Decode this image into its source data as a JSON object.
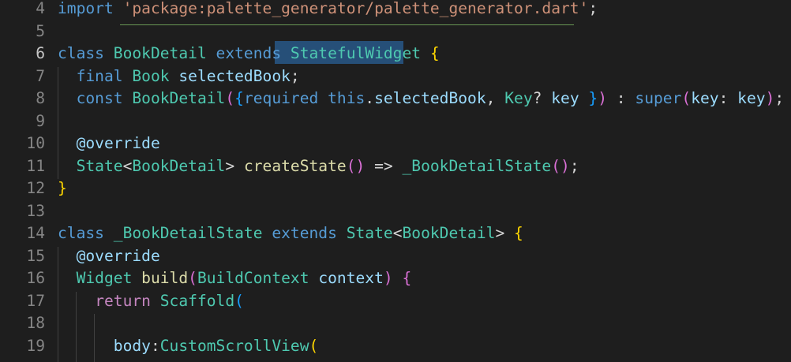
{
  "editor": {
    "language": "dart",
    "theme": "dark",
    "colors": {
      "background": "#1e1e1e",
      "keyword": "#569cd6",
      "control": "#c586c0",
      "type": "#4ec9b0",
      "function": "#dcdcaa",
      "variable": "#9cdcfe",
      "string": "#ce9178",
      "text": "#d4d4d4",
      "line_number": "#858585",
      "selection": "#264f78",
      "bracket_1": "#ffd700",
      "bracket_2": "#da70d6",
      "bracket_3": "#179fff"
    },
    "selected_text": "StatefulWidget",
    "lines": [
      {
        "number": "4",
        "tokens": [
          {
            "t": "import",
            "c": "kw"
          },
          {
            "t": " ",
            "c": "punct"
          },
          {
            "t": "'package:palette_generator/palette_generator.dart'",
            "c": "str"
          },
          {
            "t": ";",
            "c": "punct"
          }
        ]
      },
      {
        "number": "5",
        "tokens": []
      },
      {
        "number": "6",
        "active": true,
        "tokens": [
          {
            "t": "class",
            "c": "kw"
          },
          {
            "t": " ",
            "c": "punct"
          },
          {
            "t": "BookDetail",
            "c": "type"
          },
          {
            "t": " ",
            "c": "punct"
          },
          {
            "t": "extends",
            "c": "kw"
          },
          {
            "t": " ",
            "c": "punct"
          },
          {
            "t": "StatefulWidget",
            "c": "type"
          },
          {
            "t": " ",
            "c": "punct"
          },
          {
            "t": "{",
            "c": "b1"
          }
        ]
      },
      {
        "number": "7",
        "tokens": [
          {
            "t": "  ",
            "c": "punct"
          },
          {
            "t": "final",
            "c": "kw"
          },
          {
            "t": " ",
            "c": "punct"
          },
          {
            "t": "Book",
            "c": "type"
          },
          {
            "t": " ",
            "c": "punct"
          },
          {
            "t": "selectedBook",
            "c": "var"
          },
          {
            "t": ";",
            "c": "punct"
          }
        ]
      },
      {
        "number": "8",
        "tokens": [
          {
            "t": "  ",
            "c": "punct"
          },
          {
            "t": "const",
            "c": "kw"
          },
          {
            "t": " ",
            "c": "punct"
          },
          {
            "t": "BookDetail",
            "c": "type"
          },
          {
            "t": "(",
            "c": "b2"
          },
          {
            "t": "{",
            "c": "b3"
          },
          {
            "t": "required",
            "c": "kw"
          },
          {
            "t": " ",
            "c": "punct"
          },
          {
            "t": "this",
            "c": "kw"
          },
          {
            "t": ".",
            "c": "punct"
          },
          {
            "t": "selectedBook",
            "c": "var"
          },
          {
            "t": ", ",
            "c": "punct"
          },
          {
            "t": "Key",
            "c": "type"
          },
          {
            "t": "? ",
            "c": "punct"
          },
          {
            "t": "key",
            "c": "var"
          },
          {
            "t": " ",
            "c": "punct"
          },
          {
            "t": "}",
            "c": "b3"
          },
          {
            "t": ")",
            "c": "b2"
          },
          {
            "t": " : ",
            "c": "punct"
          },
          {
            "t": "super",
            "c": "kw"
          },
          {
            "t": "(",
            "c": "b2"
          },
          {
            "t": "key",
            "c": "var"
          },
          {
            "t": ": ",
            "c": "punct"
          },
          {
            "t": "key",
            "c": "var"
          },
          {
            "t": ")",
            "c": "b2"
          },
          {
            "t": ";",
            "c": "punct"
          }
        ]
      },
      {
        "number": "9",
        "tokens": []
      },
      {
        "number": "10",
        "tokens": [
          {
            "t": "  ",
            "c": "punct"
          },
          {
            "t": "@override",
            "c": "var"
          }
        ]
      },
      {
        "number": "11",
        "tokens": [
          {
            "t": "  ",
            "c": "punct"
          },
          {
            "t": "State",
            "c": "type"
          },
          {
            "t": "<",
            "c": "punct"
          },
          {
            "t": "BookDetail",
            "c": "type"
          },
          {
            "t": "> ",
            "c": "punct"
          },
          {
            "t": "createState",
            "c": "fn"
          },
          {
            "t": "(",
            "c": "b2"
          },
          {
            "t": ")",
            "c": "b2"
          },
          {
            "t": " => ",
            "c": "punct"
          },
          {
            "t": "_BookDetailState",
            "c": "type"
          },
          {
            "t": "(",
            "c": "b2"
          },
          {
            "t": ")",
            "c": "b2"
          },
          {
            "t": ";",
            "c": "punct"
          }
        ]
      },
      {
        "number": "12",
        "tokens": [
          {
            "t": "}",
            "c": "b1"
          }
        ]
      },
      {
        "number": "13",
        "tokens": []
      },
      {
        "number": "14",
        "tokens": [
          {
            "t": "class",
            "c": "kw"
          },
          {
            "t": " ",
            "c": "punct"
          },
          {
            "t": "_BookDetailState",
            "c": "type"
          },
          {
            "t": " ",
            "c": "punct"
          },
          {
            "t": "extends",
            "c": "kw"
          },
          {
            "t": " ",
            "c": "punct"
          },
          {
            "t": "State",
            "c": "type"
          },
          {
            "t": "<",
            "c": "punct"
          },
          {
            "t": "BookDetail",
            "c": "type"
          },
          {
            "t": "> ",
            "c": "punct"
          },
          {
            "t": "{",
            "c": "b1"
          }
        ]
      },
      {
        "number": "15",
        "tokens": [
          {
            "t": "  ",
            "c": "punct"
          },
          {
            "t": "@override",
            "c": "var"
          }
        ]
      },
      {
        "number": "16",
        "tokens": [
          {
            "t": "  ",
            "c": "punct"
          },
          {
            "t": "Widget",
            "c": "type"
          },
          {
            "t": " ",
            "c": "punct"
          },
          {
            "t": "build",
            "c": "fn"
          },
          {
            "t": "(",
            "c": "b2"
          },
          {
            "t": "BuildContext",
            "c": "type"
          },
          {
            "t": " ",
            "c": "punct"
          },
          {
            "t": "context",
            "c": "var"
          },
          {
            "t": ")",
            "c": "b2"
          },
          {
            "t": " ",
            "c": "punct"
          },
          {
            "t": "{",
            "c": "b2"
          }
        ]
      },
      {
        "number": "17",
        "tokens": [
          {
            "t": "    ",
            "c": "punct"
          },
          {
            "t": "return",
            "c": "ctrl"
          },
          {
            "t": " ",
            "c": "punct"
          },
          {
            "t": "Scaffold",
            "c": "type"
          },
          {
            "t": "(",
            "c": "b3"
          }
        ]
      },
      {
        "number": "18",
        "tokens": []
      },
      {
        "number": "19",
        "tokens": [
          {
            "t": "      ",
            "c": "punct"
          },
          {
            "t": "body",
            "c": "var"
          },
          {
            "t": ":",
            "c": "punct"
          },
          {
            "t": "CustomScrollView",
            "c": "type"
          },
          {
            "t": "(",
            "c": "b1"
          }
        ]
      }
    ]
  }
}
